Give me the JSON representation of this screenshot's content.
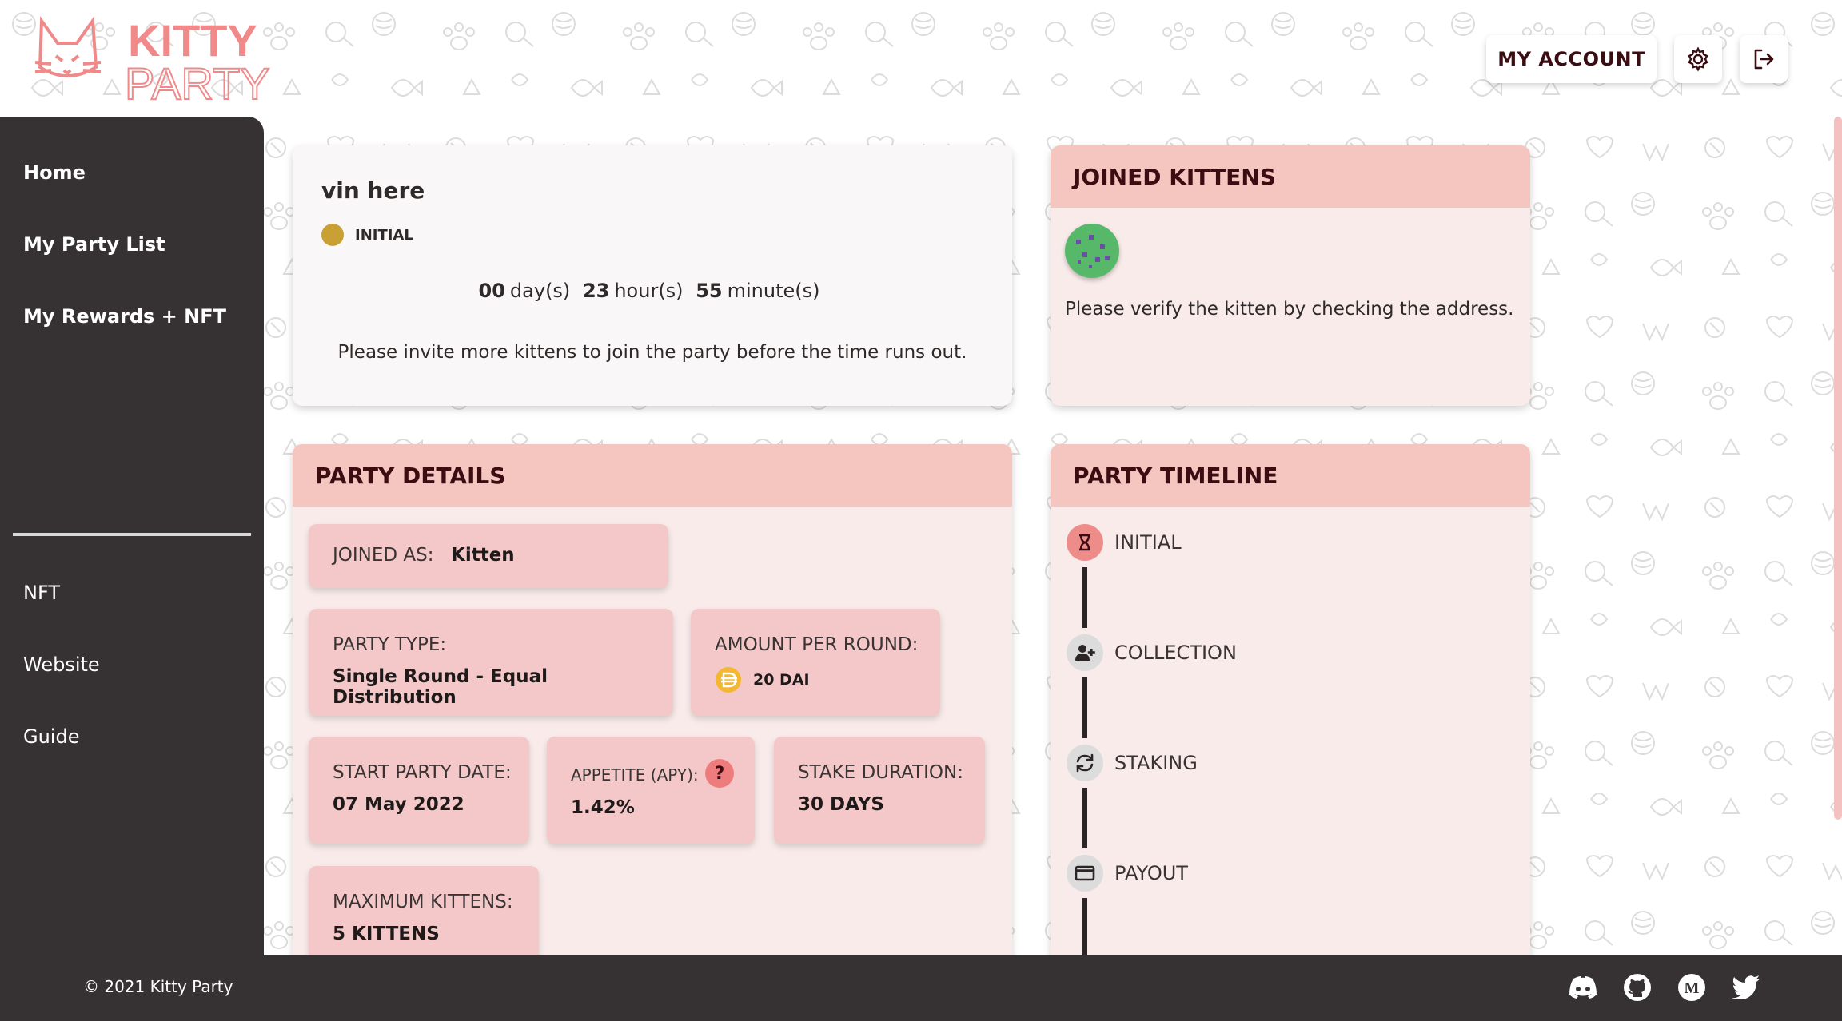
{
  "brand": {
    "name_line1": "KITTY",
    "name_line2": "PARTY",
    "color": "#f08a8a"
  },
  "header": {
    "account_label": "MY ACCOUNT",
    "settings_icon": "gear-icon",
    "logout_icon": "logout-icon"
  },
  "sidebar": {
    "primary_items": [
      {
        "label": "Home"
      },
      {
        "label": "My Party List"
      },
      {
        "label": "My Rewards + NFT"
      }
    ],
    "secondary_items": [
      {
        "label": "NFT"
      },
      {
        "label": "Website"
      },
      {
        "label": "Guide"
      }
    ]
  },
  "status_card": {
    "title": "vin here",
    "status": "INITIAL",
    "countdown": {
      "days": "00",
      "days_unit": "day(s)",
      "hours": "23",
      "hours_unit": "hour(s)",
      "minutes": "55",
      "minutes_unit": "minute(s)"
    },
    "message": "Please invite more kittens to join the party before the time runs out."
  },
  "joined_kittens": {
    "title": "JOINED KITTENS",
    "message": "Please verify the kitten by checking the address."
  },
  "party_details": {
    "title": "PARTY DETAILS",
    "joined_as_label": "JOINED AS:",
    "joined_as_value": "Kitten",
    "party_type_label": "PARTY TYPE:",
    "party_type_value": "Single Round - Equal Distribution",
    "amount_label": "AMOUNT PER ROUND:",
    "amount_value": "20 DAI",
    "start_date_label": "START PARTY DATE:",
    "start_date_value": "07 May 2022",
    "apy_label": "APPETITE (APY):",
    "apy_help": "?",
    "apy_value": "1.42%",
    "stake_label": "STAKE DURATION:",
    "stake_value": "30 DAYS",
    "max_label": "MAXIMUM KITTENS:",
    "max_value": "5 KITTENS"
  },
  "timeline": {
    "title": "PARTY TIMELINE",
    "steps": [
      {
        "label": "INITIAL",
        "icon": "hourglass-icon"
      },
      {
        "label": "COLLECTION",
        "icon": "add-user-icon"
      },
      {
        "label": "STAKING",
        "icon": "sync-icon"
      },
      {
        "label": "PAYOUT",
        "icon": "card-icon"
      }
    ]
  },
  "footer": {
    "copyright": "© 2021 Kitty Party",
    "socials": [
      "discord-icon",
      "github-icon",
      "medium-icon",
      "twitter-icon"
    ]
  },
  "colors": {
    "accent_pink": "#f5c6c0",
    "sidebar_bg": "#363132",
    "status_dot": "#c9a033",
    "dai": "#f4b731"
  }
}
